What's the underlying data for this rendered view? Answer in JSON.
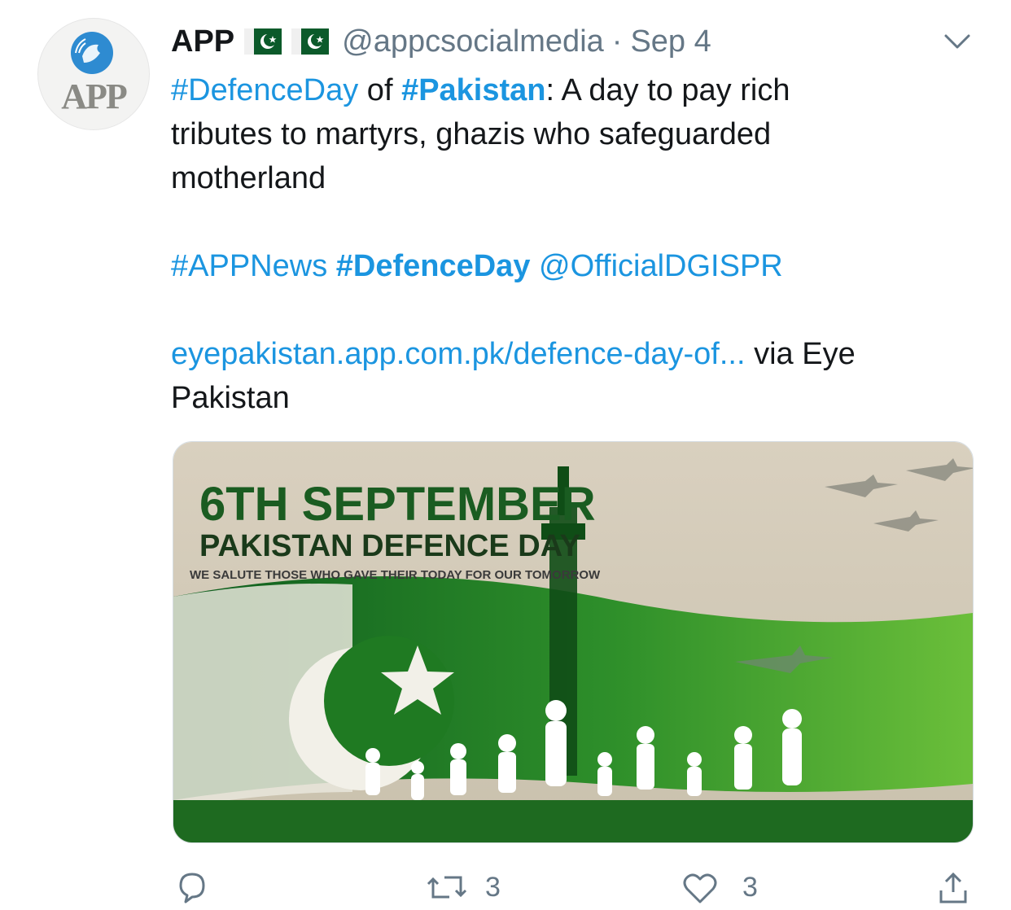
{
  "tweet": {
    "author_name": "APP",
    "handle": "@appcsocialmedia",
    "separator": "·",
    "date": "Sep 4",
    "avatar_text": "APP",
    "hashtag1": "#DefenceDay",
    "word_of": " of ",
    "hashtag2": "#Pakistan",
    "line1_rest": ": A day to pay rich",
    "line2": "tributes to martyrs, ghazis who safeguarded",
    "line3": "motherland",
    "tag_appnews": "#APPNews",
    "tag_defenceday": "#DefenceDay",
    "mention": "@OfficialDGISPR",
    "link": "eyepakistan.app.com.pk/defence-day-of...",
    "via_text": " via Eye",
    "via_text2": "Pakistan"
  },
  "media": {
    "headline1": "6TH SEPTEMBER",
    "headline2": "PAKISTAN DEFENCE DAY",
    "tagline": "WE SALUTE THOSE WHO GAVE THEIR TODAY FOR OUR TOMORROW"
  },
  "actions": {
    "retweet_count": "3",
    "like_count": "3"
  },
  "colors": {
    "link_blue": "#1b95e0",
    "secondary_gray": "#657786",
    "flag_green": "#0b5a2a"
  },
  "icons": [
    "pakistan-flag-icon",
    "chevron-down-icon",
    "reply-icon",
    "retweet-icon",
    "like-icon",
    "share-icon"
  ]
}
